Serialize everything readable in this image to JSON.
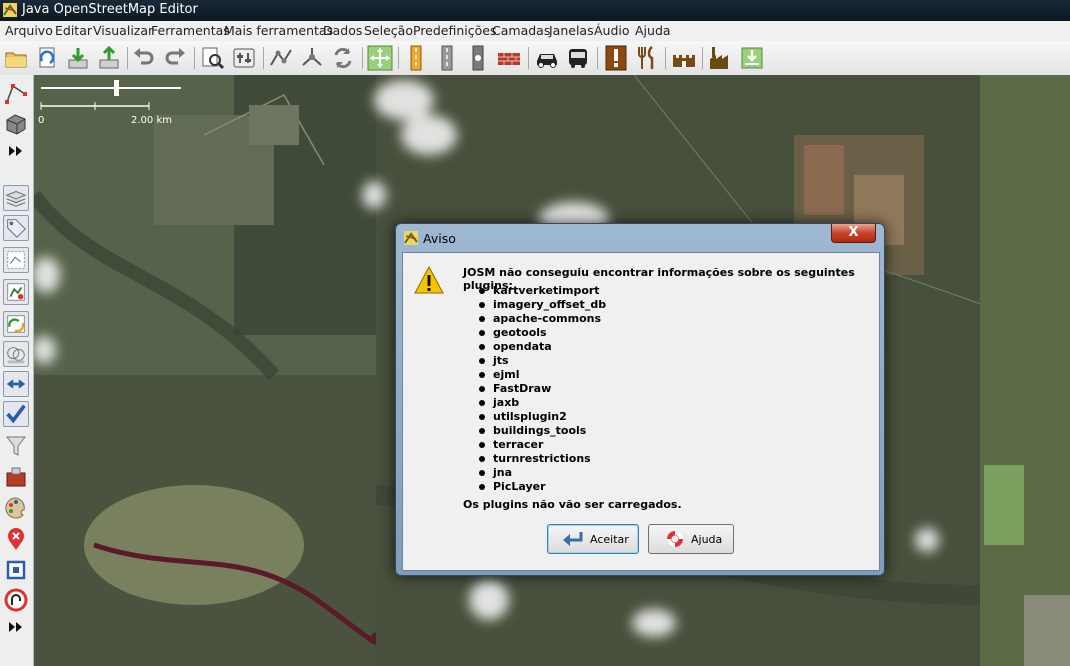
{
  "window": {
    "title": "Java OpenStreetMap Editor"
  },
  "menu": [
    "Arquivo",
    "Editar",
    "Visualizar",
    "Ferramentas",
    "Mais ferramentas",
    "Dados",
    "Seleção",
    "Predefinições",
    "Camadas",
    "Janelas",
    "Áudio",
    "Ajuda"
  ],
  "scale_bar": {
    "start": "0",
    "end": "2.00 km"
  },
  "dialog": {
    "title": "Aviso",
    "close": "X",
    "message": "JOSM não conseguiu encontrar informações sobre os seguintes plugins:",
    "plugins": [
      "kartverketimport",
      "imagery_offset_db",
      "apache-commons",
      "geotools",
      "opendata",
      "jts",
      "ejml",
      "FastDraw",
      "jaxb",
      "utilsplugin2",
      "buildings_tools",
      "terracer",
      "turnrestrictions",
      "jna",
      "PicLayer"
    ],
    "footer": "Os plugins não vão ser carregados.",
    "accept_label": "Aceitar",
    "help_label": "Ajuda"
  },
  "colors": {
    "titlebar": "#0d1722",
    "dialog_frame": "#8aa6c4",
    "close_button": "#c8432b",
    "map_base": "#4a5a3a"
  }
}
